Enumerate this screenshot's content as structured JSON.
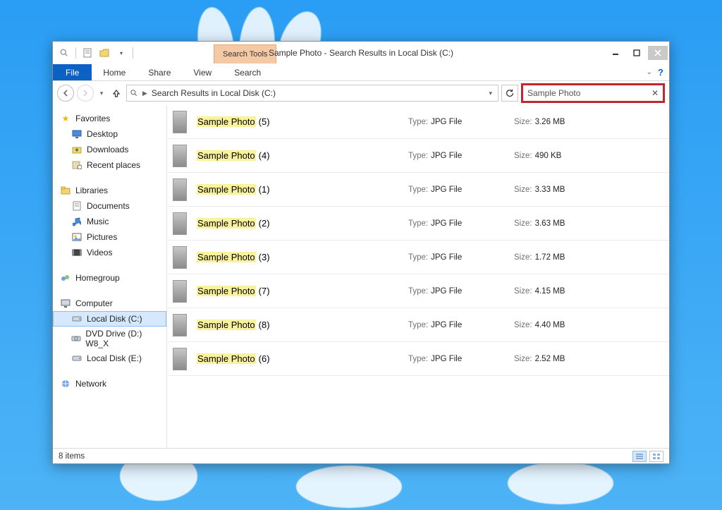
{
  "titlebar": {
    "title": "Sample Photo - Search Results in Local Disk (C:)",
    "search_tools_label": "Search Tools"
  },
  "ribbon": {
    "file": "File",
    "tabs": [
      "Home",
      "Share",
      "View",
      "Search"
    ]
  },
  "addressbar": {
    "crumb": "Search Results in Local Disk (C:)"
  },
  "search": {
    "value": "Sample Photo"
  },
  "sidebar": {
    "favorites": {
      "label": "Favorites",
      "items": [
        {
          "icon": "desktop",
          "label": "Desktop"
        },
        {
          "icon": "downloads",
          "label": "Downloads"
        },
        {
          "icon": "recent",
          "label": "Recent places"
        }
      ]
    },
    "libraries": {
      "label": "Libraries",
      "items": [
        {
          "icon": "documents",
          "label": "Documents"
        },
        {
          "icon": "music",
          "label": "Music"
        },
        {
          "icon": "pictures",
          "label": "Pictures"
        },
        {
          "icon": "videos",
          "label": "Videos"
        }
      ]
    },
    "homegroup": {
      "label": "Homegroup"
    },
    "computer": {
      "label": "Computer",
      "items": [
        {
          "icon": "disk",
          "label": "Local Disk (C:)",
          "selected": true
        },
        {
          "icon": "dvd",
          "label": "DVD Drive (D:) W8_X"
        },
        {
          "icon": "disk",
          "label": "Local Disk (E:)"
        }
      ]
    },
    "network": {
      "label": "Network"
    }
  },
  "labels": {
    "type": "Type:",
    "size": "Size:"
  },
  "results": [
    {
      "name": "Sample Photo",
      "suffix": " (5)",
      "type": "JPG File",
      "size": "3.26 MB"
    },
    {
      "name": "Sample Photo",
      "suffix": " (4)",
      "type": "JPG File",
      "size": "490 KB"
    },
    {
      "name": "Sample Photo",
      "suffix": " (1)",
      "type": "JPG File",
      "size": "3.33 MB"
    },
    {
      "name": "Sample Photo",
      "suffix": " (2)",
      "type": "JPG File",
      "size": "3.63 MB"
    },
    {
      "name": "Sample Photo",
      "suffix": " (3)",
      "type": "JPG File",
      "size": "1.72 MB"
    },
    {
      "name": "Sample Photo",
      "suffix": " (7)",
      "type": "JPG File",
      "size": "4.15 MB"
    },
    {
      "name": "Sample Photo",
      "suffix": " (8)",
      "type": "JPG File",
      "size": "4.40 MB"
    },
    {
      "name": "Sample Photo",
      "suffix": " (6)",
      "type": "JPG File",
      "size": "2.52 MB"
    }
  ],
  "statusbar": {
    "count": "8 items"
  }
}
